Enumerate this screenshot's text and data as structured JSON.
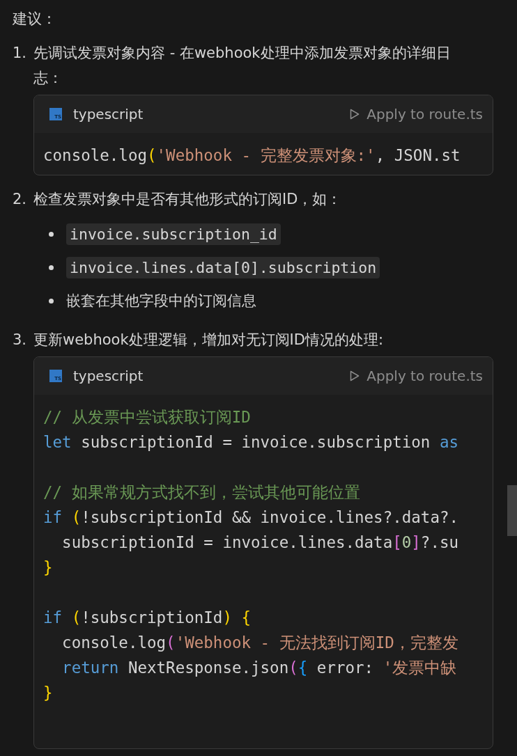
{
  "heading": "建议：",
  "steps": [
    {
      "number": "1.",
      "text": "先调试发票对象内容 - 在webhook处理中添加发票对象的详细日志：",
      "code_block": {
        "icon_text": "TS",
        "language": "typescript",
        "action": "Apply to route.ts",
        "lines": [
          {
            "kind": "code",
            "tokens": [
              {
                "kind": "plain",
                "text": "console.log"
              },
              {
                "kind": "bracket1",
                "text": "("
              },
              {
                "kind": "string",
                "text": "'Webhook - 完整发票对象:'"
              },
              {
                "kind": "plain",
                "text": ", JSON.st"
              }
            ]
          }
        ]
      }
    },
    {
      "number": "2.",
      "text": "检查发票对象中是否有其他形式的订阅ID，如：",
      "bullets": [
        {
          "kind": "code",
          "text": "invoice.subscription_id"
        },
        {
          "kind": "code",
          "text": "invoice.lines.data[0].subscription"
        },
        {
          "kind": "text",
          "text": "嵌套在其他字段中的订阅信息"
        }
      ]
    },
    {
      "number": "3.",
      "text": "更新webhook处理逻辑，增加对无订阅ID情况的处理:",
      "code_block": {
        "icon_text": "TS",
        "language": "typescript",
        "action": "Apply to route.ts",
        "lines": [
          {
            "kind": "code",
            "tokens": [
              {
                "kind": "comment",
                "text": "// 从发票中尝试获取订阅ID"
              }
            ]
          },
          {
            "kind": "code",
            "tokens": [
              {
                "kind": "keyword",
                "text": "let"
              },
              {
                "kind": "plain",
                "text": " subscriptionId = invoice.subscription "
              },
              {
                "kind": "keyword",
                "text": "as"
              }
            ]
          },
          {
            "kind": "blank"
          },
          {
            "kind": "code",
            "tokens": [
              {
                "kind": "comment",
                "text": "// 如果常规方式找不到，尝试其他可能位置"
              }
            ]
          },
          {
            "kind": "code",
            "tokens": [
              {
                "kind": "keyword",
                "text": "if"
              },
              {
                "kind": "bracket1",
                "text": " ("
              },
              {
                "kind": "plain",
                "text": "!subscriptionId && invoice.lines?.data?."
              }
            ]
          },
          {
            "kind": "code",
            "tokens": [
              {
                "kind": "plain",
                "text": "  subscriptionId = invoice.lines.data"
              },
              {
                "kind": "bracket2",
                "text": "["
              },
              {
                "kind": "number",
                "text": "0"
              },
              {
                "kind": "bracket2",
                "text": "]"
              },
              {
                "kind": "plain",
                "text": "?.su"
              }
            ]
          },
          {
            "kind": "code",
            "tokens": [
              {
                "kind": "bracket1",
                "text": "}"
              }
            ]
          },
          {
            "kind": "blank"
          },
          {
            "kind": "code",
            "tokens": [
              {
                "kind": "keyword",
                "text": "if"
              },
              {
                "kind": "bracket1",
                "text": " ("
              },
              {
                "kind": "plain",
                "text": "!subscriptionId"
              },
              {
                "kind": "bracket1",
                "text": ") {"
              }
            ]
          },
          {
            "kind": "code",
            "tokens": [
              {
                "kind": "plain",
                "text": "  console.log"
              },
              {
                "kind": "bracket2",
                "text": "("
              },
              {
                "kind": "string",
                "text": "'Webhook - 无法找到订阅ID，完整发"
              }
            ]
          },
          {
            "kind": "code",
            "tokens": [
              {
                "kind": "keyword",
                "text": "  return"
              },
              {
                "kind": "plain",
                "text": " NextResponse.json"
              },
              {
                "kind": "bracket2",
                "text": "("
              },
              {
                "kind": "bracket3",
                "text": "{"
              },
              {
                "kind": "plain",
                "text": " error: "
              },
              {
                "kind": "string",
                "text": "'发票中缺"
              }
            ]
          },
          {
            "kind": "code",
            "tokens": [
              {
                "kind": "bracket1",
                "text": "}"
              }
            ]
          }
        ]
      }
    }
  ]
}
